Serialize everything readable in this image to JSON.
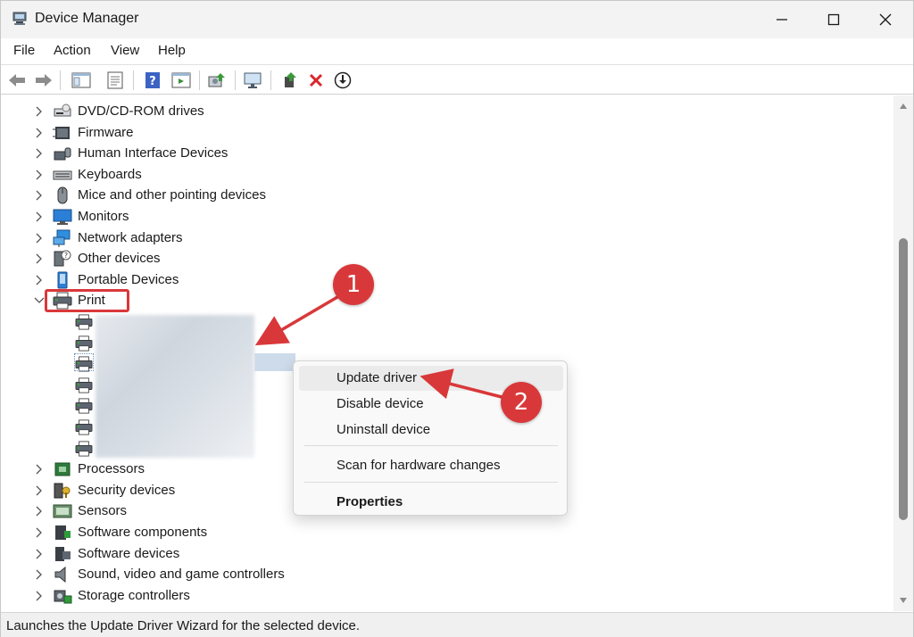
{
  "window": {
    "title": "Device Manager"
  },
  "menu": [
    "File",
    "Action",
    "View",
    "Help"
  ],
  "tree": {
    "categories_before": [
      {
        "label": "DVD/CD-ROM drives",
        "icon": "dvd-drive-icon"
      },
      {
        "label": "Firmware",
        "icon": "firmware-icon"
      },
      {
        "label": "Human Interface Devices",
        "icon": "hid-icon"
      },
      {
        "label": "Keyboards",
        "icon": "keyboard-icon"
      },
      {
        "label": "Mice and other pointing devices",
        "icon": "mouse-icon"
      },
      {
        "label": "Monitors",
        "icon": "monitor-icon"
      },
      {
        "label": "Network adapters",
        "icon": "network-adapter-icon"
      },
      {
        "label": "Other devices",
        "icon": "unknown-device-icon"
      },
      {
        "label": "Portable Devices",
        "icon": "portable-device-icon"
      }
    ],
    "expanded": {
      "label": "Print",
      "icon": "printer-icon"
    },
    "printer_children_count": 7,
    "categories_after": [
      {
        "label": "Processors",
        "icon": "processor-icon"
      },
      {
        "label": "Security devices",
        "icon": "security-device-icon"
      },
      {
        "label": "Sensors",
        "icon": "sensor-icon"
      },
      {
        "label": "Software components",
        "icon": "software-component-icon"
      },
      {
        "label": "Software devices",
        "icon": "software-device-icon"
      },
      {
        "label": "Sound, video and game controllers",
        "icon": "speaker-icon"
      },
      {
        "label": "Storage controllers",
        "icon": "storage-controller-icon"
      }
    ]
  },
  "context_menu": {
    "update_driver": "Update driver",
    "disable_device": "Disable device",
    "uninstall_device": "Uninstall device",
    "scan": "Scan for hardware changes",
    "properties": "Properties"
  },
  "annotations": {
    "step1": "1",
    "step2": "2",
    "color": "#d9383a"
  },
  "status": "Launches the Update Driver Wizard for the selected device."
}
